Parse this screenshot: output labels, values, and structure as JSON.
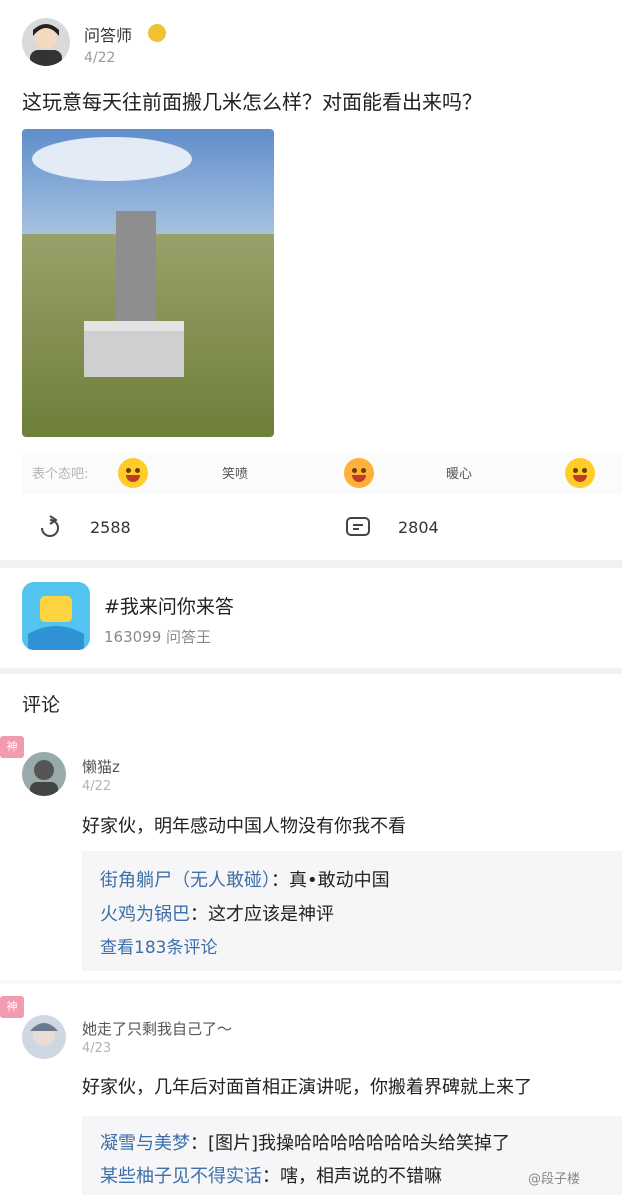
{
  "post": {
    "author": "问答师",
    "date": "4/22",
    "text": "这玩意每天往前面搬几米怎么样？对面能看出来吗？",
    "image_alt": "grassland-border-marker-photo"
  },
  "reactions": {
    "prompt": "表个态吧:",
    "items": [
      {
        "label": "笑喷",
        "icon": "laughing-face-icon"
      },
      {
        "label": "暖心",
        "icon": "heart-face-icon"
      },
      {
        "label": "",
        "icon": "grinning-face-icon"
      }
    ]
  },
  "stats": {
    "share_count": "2588",
    "comment_count": "2804"
  },
  "topic": {
    "title": "#我来问你来答",
    "meta": "163099 问答王"
  },
  "comments_header": "评论",
  "comments": [
    {
      "badge": "神",
      "user": "懒猫z",
      "date": "4/22",
      "text": "好家伙，明年感动中国人物没有你我不看",
      "replies": [
        {
          "user": "街角躺尸（无人敢碰）",
          "sep": "：",
          "text": "真•敢动中国"
        },
        {
          "user": "火鸡为锅巴",
          "sep": "：",
          "text": "这才应该是神评"
        }
      ],
      "more": "查看183条评论"
    },
    {
      "badge": "神",
      "user": "她走了只剩我自己了～",
      "date": "4/23",
      "text": "好家伙，几年后对面首相正演讲呢，你搬着界碑就上来了",
      "replies": [
        {
          "user": "凝雪与美梦",
          "sep": "：",
          "text": "[图片]我操哈哈哈哈哈哈哈头给笑掉了"
        },
        {
          "user": "某些柚子见不得实话",
          "sep": "：",
          "text": "嗐，相声说的不错嘛"
        }
      ]
    }
  ],
  "watermark": "@段子楼"
}
